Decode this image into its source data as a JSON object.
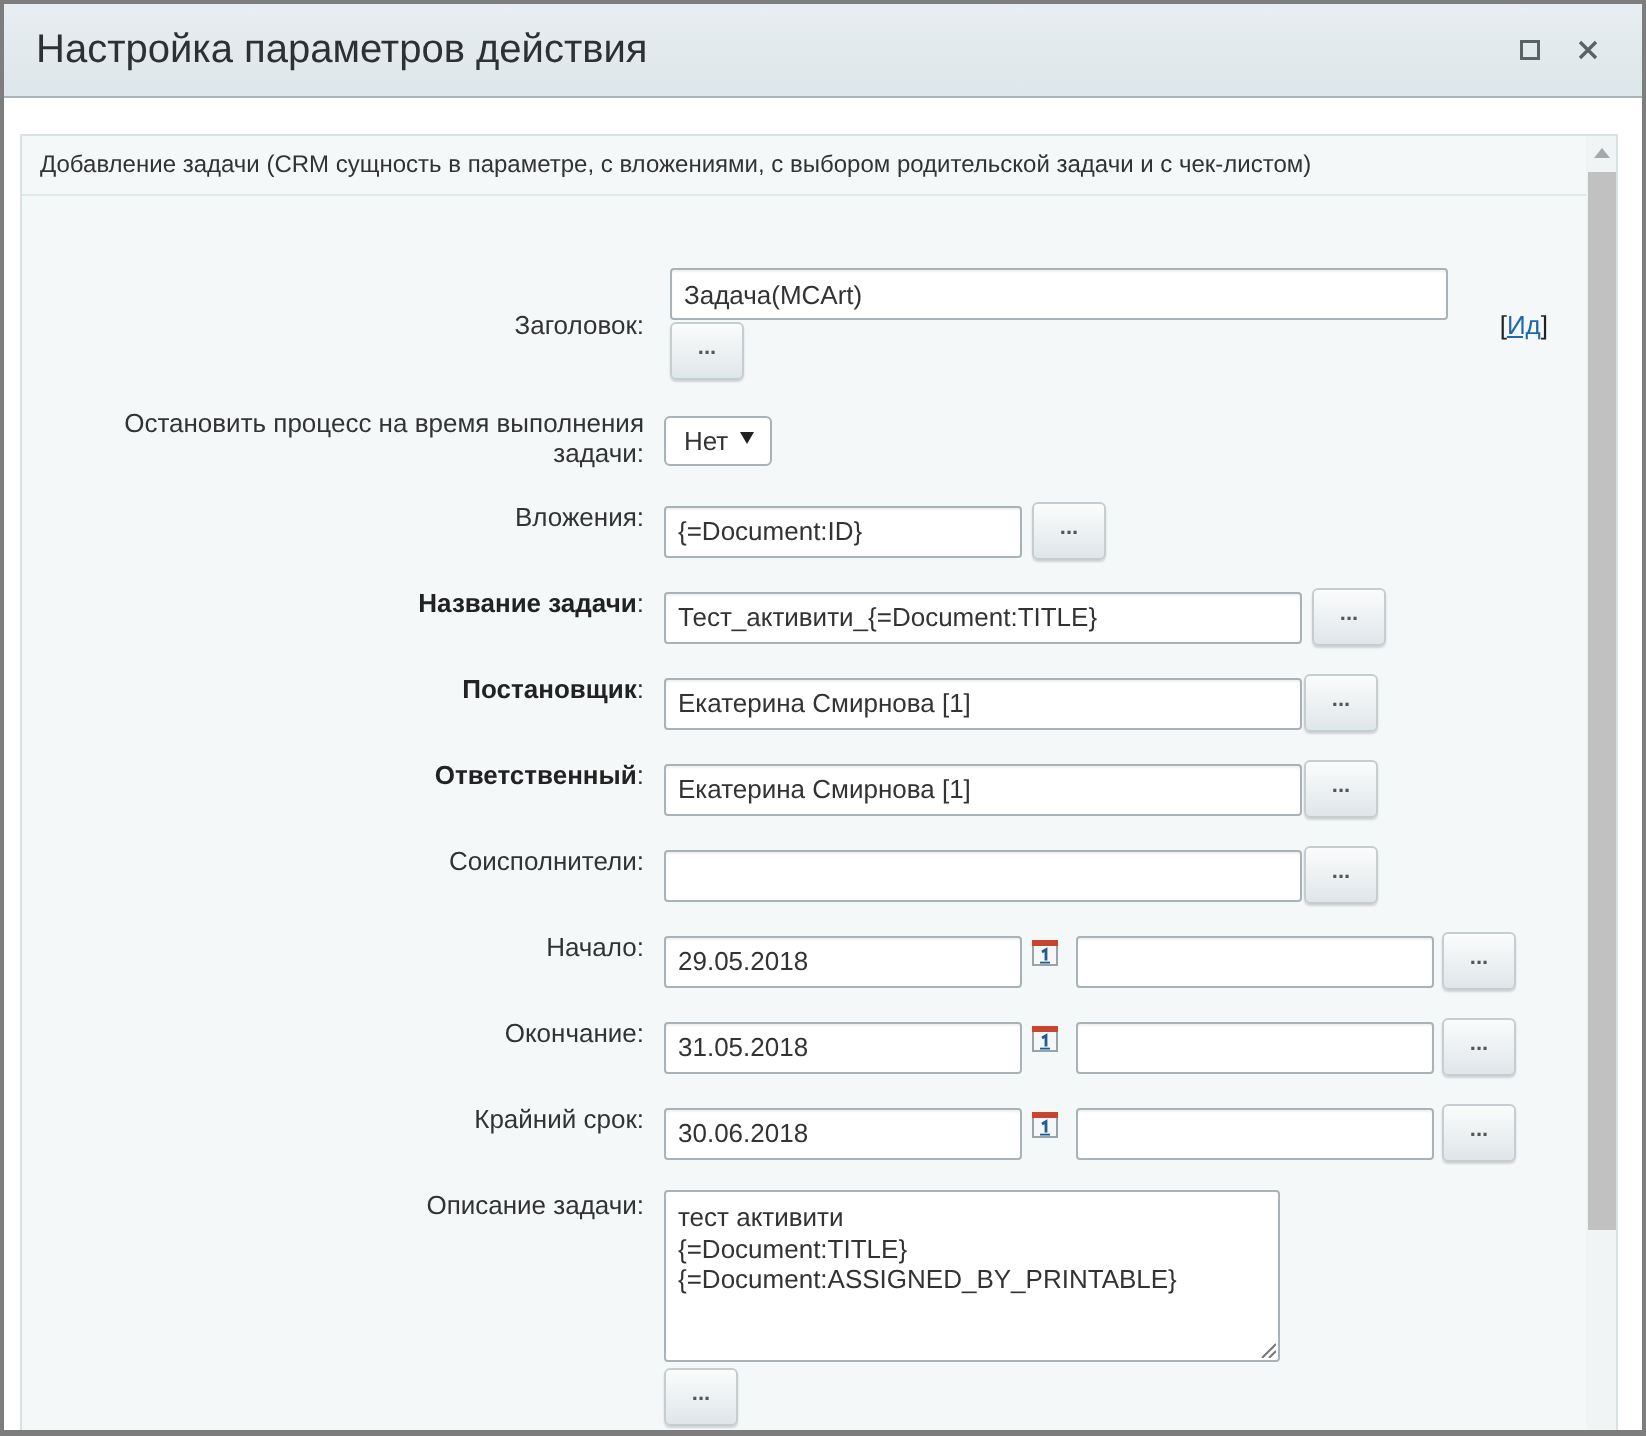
{
  "window": {
    "title": "Настройка параметров действия"
  },
  "panel": {
    "heading": "Добавление задачи (CRM сущность в параметре, с вложениями, с выбором родительской задачи и с чек-листом)"
  },
  "fields": [
    {
      "kind": "text_stacked",
      "label": "Заголовок:",
      "value": "Задача(MCArt)",
      "button": "...",
      "link": {
        "before": "[",
        "text": "Ид",
        "after": "]"
      }
    },
    {
      "kind": "select",
      "label": "Остановить процесс на время выполнения задачи:",
      "value": "Нет"
    },
    {
      "kind": "file",
      "label": "Вложения:",
      "value": "{=Document:ID}",
      "button": "..."
    },
    {
      "kind": "text",
      "label": "**Название задачи**:",
      "value": "Тест_активити_{=Document:TITLE}",
      "button": "..."
    },
    {
      "kind": "user",
      "label": "**Постановщик**:",
      "value": "Екатерина Смирнова [1]",
      "button": "..."
    },
    {
      "kind": "user",
      "label": "**Ответственный**:",
      "value": "Екатерина Смирнова [1]",
      "button": "..."
    },
    {
      "kind": "user",
      "label": "Соисполнители:",
      "button": "..."
    },
    {
      "kind": "date",
      "label": "Начало:",
      "value": "29.05.2018",
      "button": "..."
    },
    {
      "kind": "date",
      "label": "Окончание:",
      "value": "31.05.2018",
      "button": "..."
    },
    {
      "kind": "date",
      "label": "Крайний срок:",
      "value": "30.06.2018",
      "button": "..."
    },
    {
      "kind": "textarea",
      "label": "Описание задачи:",
      "value": "тест активити\n{=Document:TITLE}\n{=Document:ASSIGNED_BY_PRINTABLE}",
      "button": "..."
    }
  ]
}
